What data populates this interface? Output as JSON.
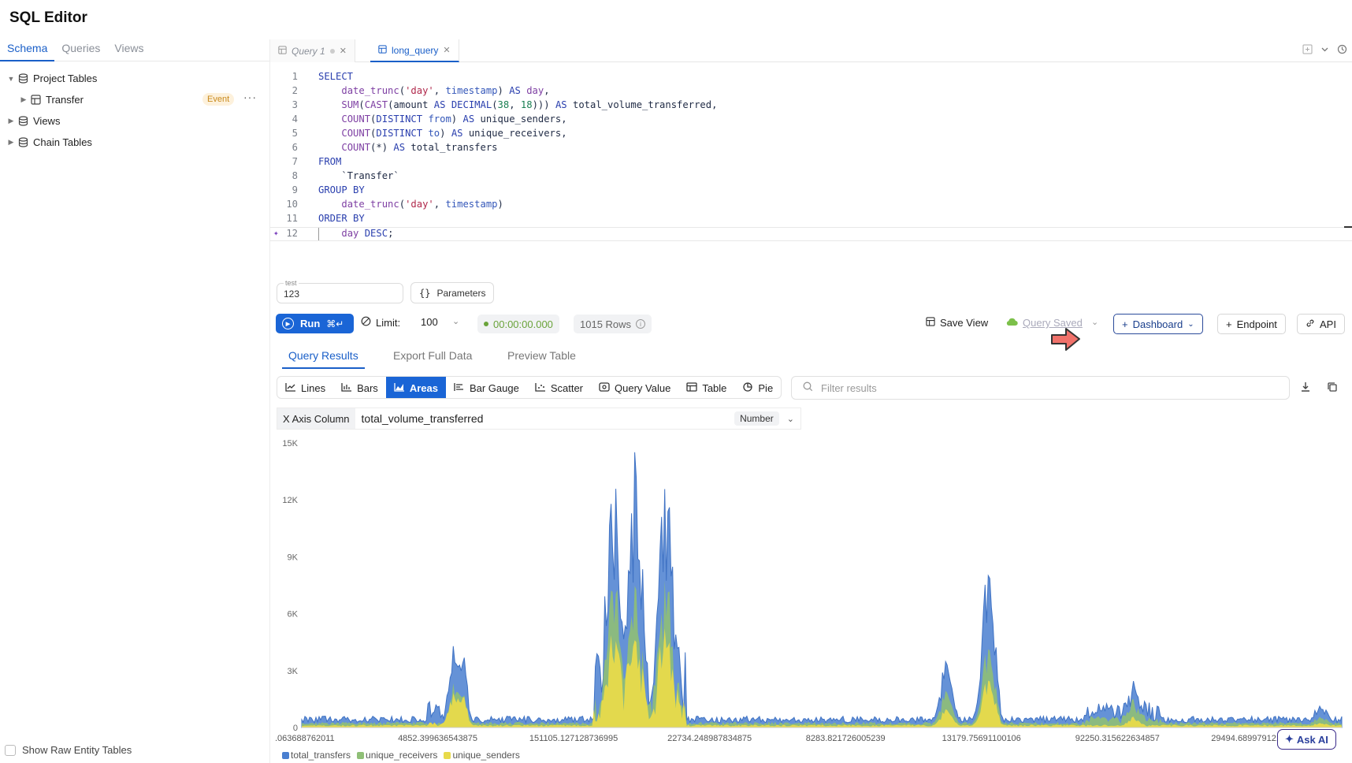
{
  "app": {
    "title": "SQL Editor"
  },
  "sidebar": {
    "tabs": [
      "Schema",
      "Queries",
      "Views"
    ],
    "active_tab": "Schema",
    "tree": [
      {
        "label": "Project Tables",
        "expanded": true,
        "level": 0,
        "icon": "database-icon"
      },
      {
        "label": "Transfer",
        "level": 1,
        "badge": "Event",
        "more": "···",
        "icon": "table-icon"
      },
      {
        "label": "Views",
        "expanded": false,
        "level": 0,
        "icon": "database-icon"
      },
      {
        "label": "Chain Tables",
        "expanded": false,
        "level": 0,
        "icon": "database-icon"
      }
    ],
    "show_raw_label": "Show Raw Entity Tables"
  },
  "editor": {
    "tabs": [
      {
        "label": "Query 1",
        "active": false
      },
      {
        "label": "long_query",
        "active": true
      }
    ],
    "lines": [
      "1",
      "2",
      "3",
      "4",
      "5",
      "6",
      "7",
      "8",
      "9",
      "10",
      "11",
      "12"
    ]
  },
  "params": {
    "label": "test",
    "value": "123",
    "button_label": "Parameters"
  },
  "toolbar": {
    "run_label": "Run",
    "run_shortcut": "⌘↵",
    "limit_label": "Limit:",
    "limit_value": "100",
    "timer": "00:00:00.000",
    "rows": "1015 Rows",
    "save_view": "Save View",
    "query_saved": "Query Saved",
    "dashboard": "Dashboard",
    "endpoint": "Endpoint",
    "api": "API"
  },
  "results": {
    "tabs": [
      "Query Results",
      "Export Full Data",
      "Preview Table"
    ],
    "active_tab": "Query Results",
    "chart_types": [
      "Lines",
      "Bars",
      "Areas",
      "Bar Gauge",
      "Scatter",
      "Query Value",
      "Table",
      "Pie"
    ],
    "active_chart_type": "Areas",
    "filter_placeholder": "Filter results",
    "x_axis_label": "X Axis Column",
    "x_axis_value": "total_volume_transferred",
    "x_axis_type": "Number",
    "ask_ai": "Ask AI"
  },
  "colors": {
    "accent": "#1a65d6",
    "series_total_transfers": "#4a7fd0",
    "series_unique_receivers": "#8fbf77",
    "series_unique_senders": "#e8da4a"
  },
  "chart_data": {
    "type": "area",
    "ylim": [
      0,
      15000
    ],
    "y_ticks": [
      "0",
      "3K",
      "6K",
      "9K",
      "12K",
      "15K"
    ],
    "x_tick_labels": [
      ".063688762011",
      "4852.399636543875",
      "151105.127128736995",
      "22734.248987834875",
      "8283.821726005239",
      "13179.75691100106",
      "92250.315622634857",
      "29494.689979121449"
    ],
    "legend": [
      "total_transfers",
      "unique_receivers",
      "unique_senders"
    ],
    "peaks": [
      {
        "x": 0.06,
        "total_transfers": 300,
        "unique_receivers": 200,
        "unique_senders": 100
      },
      {
        "x": 0.1,
        "total_transfers": 400,
        "unique_receivers": 250,
        "unique_senders": 150
      },
      {
        "x": 0.15,
        "total_transfers": 5000,
        "unique_receivers": 3000,
        "unique_senders": 2000
      },
      {
        "x": 0.3,
        "total_transfers": 11000,
        "unique_receivers": 7000,
        "unique_senders": 4000
      },
      {
        "x": 0.32,
        "total_transfers": 13500,
        "unique_receivers": 8000,
        "unique_senders": 5000
      },
      {
        "x": 0.35,
        "total_transfers": 12200,
        "unique_receivers": 7000,
        "unique_senders": 4500
      },
      {
        "x": 0.62,
        "total_transfers": 3600,
        "unique_receivers": 2000,
        "unique_senders": 1000
      },
      {
        "x": 0.66,
        "total_transfers": 9700,
        "unique_receivers": 5000,
        "unique_senders": 3000
      },
      {
        "x": 0.8,
        "total_transfers": 2000,
        "unique_receivers": 1200,
        "unique_senders": 600
      },
      {
        "x": 0.98,
        "total_transfers": 1400,
        "unique_receivers": 700,
        "unique_senders": 300
      }
    ]
  }
}
